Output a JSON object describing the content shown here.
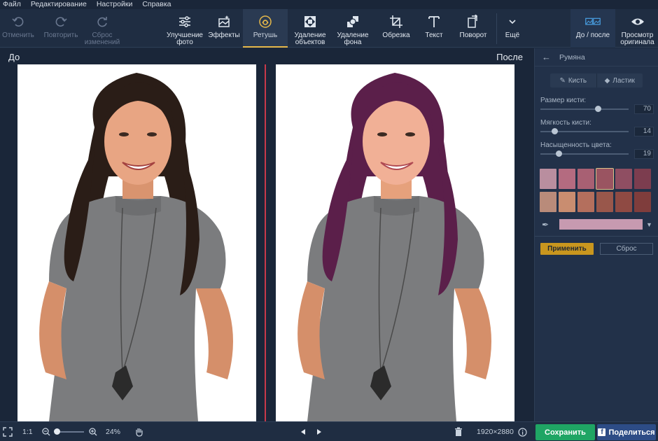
{
  "menu": [
    "Файл",
    "Редактирование",
    "Настройки",
    "Справка"
  ],
  "toolbar": {
    "undo": "Отменить",
    "redo": "Повторить",
    "reset_changes": "Сброс\nизменений",
    "enhance": "Улучшение\nфото",
    "effects": "Эффекты",
    "retouch": "Ретушь",
    "remove_objects": "Удаление\nобъектов",
    "remove_background": "Удаление\nфона",
    "crop": "Обрезка",
    "text": "Текст",
    "rotate": "Поворот",
    "more": "Ещё",
    "before_after": "До / после",
    "view_original": "Просмотр\nоригинала"
  },
  "canvas": {
    "before_label": "До",
    "after_label": "После"
  },
  "panel": {
    "title": "Румяна",
    "brush": "Кисть",
    "eraser": "Ластик",
    "brush_size_label": "Размер кисти:",
    "brush_size_value": "70",
    "brush_size_fraction": 0.66,
    "brush_softness_label": "Мягкость кисти:",
    "brush_softness_value": "14",
    "brush_softness_fraction": 0.14,
    "saturation_label": "Насыщенность цвета:",
    "saturation_value": "19",
    "saturation_fraction": 0.19,
    "swatches": [
      "#b98e9f",
      "#b46b80",
      "#a86073",
      "#9a5461",
      "#8f4e62",
      "#7c3d4f",
      "#b98b7a",
      "#c98d70",
      "#b46f5d",
      "#99574b",
      "#8f4a43",
      "#7f3d3c"
    ],
    "selected_swatch": 3,
    "selected_color": "#c79ab0",
    "apply": "Применить",
    "reset": "Сброс"
  },
  "status": {
    "ratio": "1:1",
    "zoom": "24%",
    "dimensions": "1920×2880",
    "save": "Сохранить",
    "share": "Поделиться"
  },
  "colors": {
    "accent": "#e6b84a",
    "divider": "#c8394a",
    "save": "#1fa564",
    "share": "#2d4c86"
  }
}
